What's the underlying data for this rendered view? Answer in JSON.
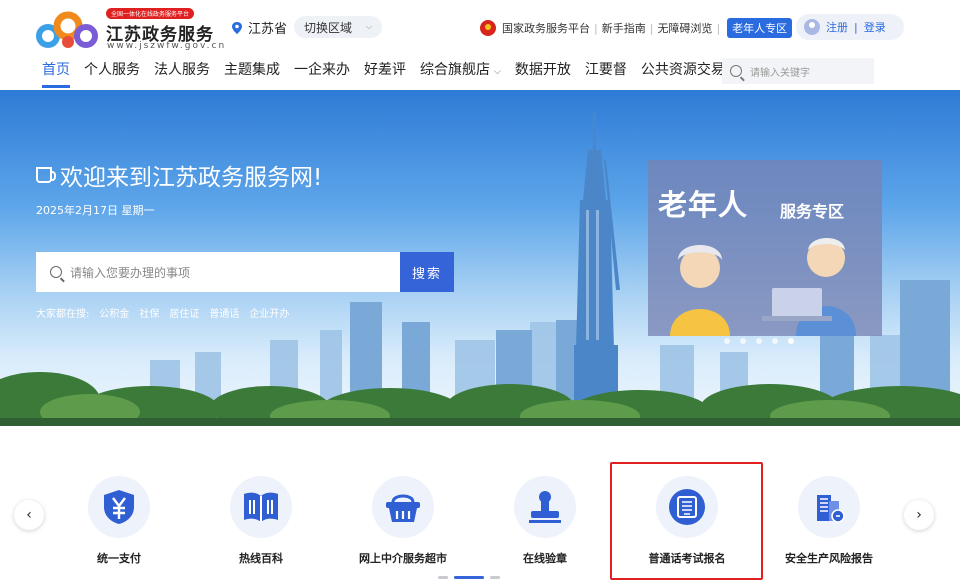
{
  "header": {
    "logo_badge": "全国一体化在线政务服务平台",
    "logo_title": "江苏政务服务",
    "logo_url": "www.jszwfw.gov.cn",
    "region": "江苏省",
    "region_switch": "切换区域",
    "links": [
      "国家政务服务平台",
      "新手指南",
      "无障碍浏览"
    ],
    "elder_label": "老年人专区",
    "register": "注册",
    "login": "登录",
    "login_sep": "|"
  },
  "nav": {
    "items": [
      "首页",
      "个人服务",
      "法人服务",
      "主题集成",
      "一企来办",
      "好差评",
      "综合旗舰店",
      "数据开放",
      "江要督",
      "公共资源交易"
    ],
    "active_index": 0,
    "search_placeholder": "请输入关键字"
  },
  "hero": {
    "welcome": "欢迎来到江苏政务服务网!",
    "date": "2025年2月17日 星期一",
    "search_placeholder": "请输入您要办理的事项",
    "search_button": "搜索",
    "hot_prefix": "大家都在搜:",
    "hot_terms": [
      "公积金",
      "社保",
      "居住证",
      "普通话",
      "企业开办"
    ],
    "banner_title": "老年人",
    "banner_sub": "服务专区",
    "banner_dots": 5,
    "banner_active_dot": 4
  },
  "services": {
    "items": [
      {
        "label": "统一支付",
        "icon": "yuan-shield-icon"
      },
      {
        "label": "热线百科",
        "icon": "open-book-icon"
      },
      {
        "label": "网上中介服务超市",
        "icon": "shopping-basket-icon"
      },
      {
        "label": "在线验章",
        "icon": "seal-stamp-icon"
      },
      {
        "label": "普通话考试报名",
        "icon": "exam-badge-icon"
      },
      {
        "label": "安全生产风险报告",
        "icon": "building-report-icon"
      }
    ],
    "page_count": 3,
    "active_page": 1
  },
  "colors": {
    "brand_blue": "#3564d8",
    "highlight_red": "#e02020"
  }
}
